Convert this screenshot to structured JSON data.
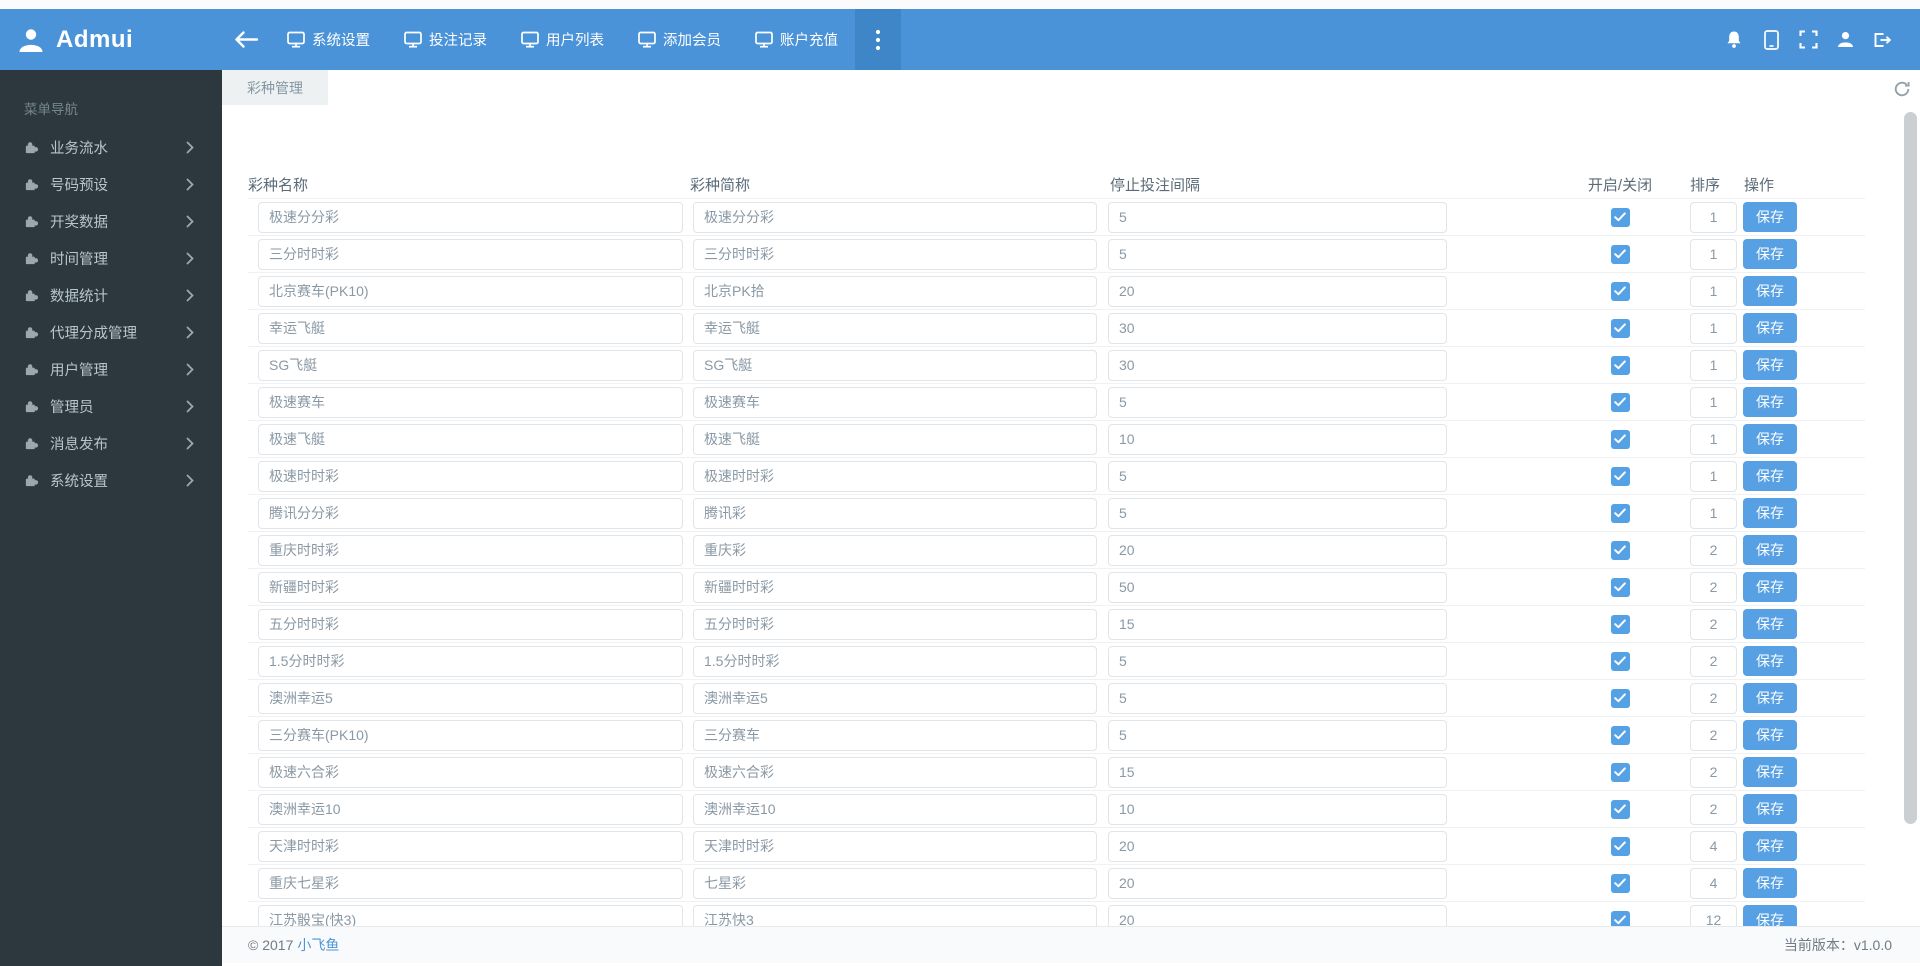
{
  "colors": {
    "navbar_blue": "#4b93d9",
    "navbar_more_darker": "#3f86c9",
    "sidebar_bg": "#2d383e",
    "accent_blue": "#58a0e4",
    "checkbox_blue": "#55a1e6",
    "link_blue": "#4b94d6",
    "tab_bg": "#edf1f2"
  },
  "navbar": {
    "brand": "Admui",
    "items": [
      {
        "label": "系统设置",
        "icon": "monitor-icon"
      },
      {
        "label": "投注记录",
        "icon": "monitor-icon"
      },
      {
        "label": "用户列表",
        "icon": "monitor-icon"
      },
      {
        "label": "添加会员",
        "icon": "monitor-icon"
      },
      {
        "label": "账户充值",
        "icon": "monitor-icon"
      }
    ],
    "right_icons": [
      "bell-icon",
      "tablet-icon",
      "fullscreen-icon",
      "user-icon",
      "logout-icon"
    ]
  },
  "sidebar": {
    "header": "菜单导航",
    "items": [
      {
        "label": "业务流水"
      },
      {
        "label": "号码预设"
      },
      {
        "label": "开奖数据"
      },
      {
        "label": "时间管理"
      },
      {
        "label": "数据统计"
      },
      {
        "label": "代理分成管理"
      },
      {
        "label": "用户管理"
      },
      {
        "label": "管理员"
      },
      {
        "label": "消息发布"
      },
      {
        "label": "系统设置"
      }
    ]
  },
  "tabs": [
    {
      "label": "彩种管理",
      "active": true
    }
  ],
  "table": {
    "headers": [
      "彩种名称",
      "彩种简称",
      "停止投注间隔",
      "开启/关闭",
      "排序",
      "操作"
    ],
    "action_label": "保存",
    "rows": [
      {
        "name": "极速分分彩",
        "short": "极速分分彩",
        "interval": "5",
        "enabled": true,
        "sort": "1"
      },
      {
        "name": "三分时时彩",
        "short": "三分时时彩",
        "interval": "5",
        "enabled": true,
        "sort": "1"
      },
      {
        "name": "北京赛车(PK10)",
        "short": "北京PK拾",
        "interval": "20",
        "enabled": true,
        "sort": "1"
      },
      {
        "name": "幸运飞艇",
        "short": "幸运飞艇",
        "interval": "30",
        "enabled": true,
        "sort": "1"
      },
      {
        "name": "SG飞艇",
        "short": "SG飞艇",
        "interval": "30",
        "enabled": true,
        "sort": "1"
      },
      {
        "name": "极速赛车",
        "short": "极速赛车",
        "interval": "5",
        "enabled": true,
        "sort": "1"
      },
      {
        "name": "极速飞艇",
        "short": "极速飞艇",
        "interval": "10",
        "enabled": true,
        "sort": "1"
      },
      {
        "name": "极速时时彩",
        "short": "极速时时彩",
        "interval": "5",
        "enabled": true,
        "sort": "1"
      },
      {
        "name": "腾讯分分彩",
        "short": "腾讯彩",
        "interval": "5",
        "enabled": true,
        "sort": "1"
      },
      {
        "name": "重庆时时彩",
        "short": "重庆彩",
        "interval": "20",
        "enabled": true,
        "sort": "2"
      },
      {
        "name": "新疆时时彩",
        "short": "新疆时时彩",
        "interval": "50",
        "enabled": true,
        "sort": "2"
      },
      {
        "name": "五分时时彩",
        "short": "五分时时彩",
        "interval": "15",
        "enabled": true,
        "sort": "2"
      },
      {
        "name": "1.5分时时彩",
        "short": "1.5分时时彩",
        "interval": "5",
        "enabled": true,
        "sort": "2"
      },
      {
        "name": "澳洲幸运5",
        "short": "澳洲幸运5",
        "interval": "5",
        "enabled": true,
        "sort": "2"
      },
      {
        "name": "三分赛车(PK10)",
        "short": "三分赛车",
        "interval": "5",
        "enabled": true,
        "sort": "2"
      },
      {
        "name": "极速六合彩",
        "short": "极速六合彩",
        "interval": "15",
        "enabled": true,
        "sort": "2"
      },
      {
        "name": "澳洲幸运10",
        "short": "澳洲幸运10",
        "interval": "10",
        "enabled": true,
        "sort": "2"
      },
      {
        "name": "天津时时彩",
        "short": "天津时时彩",
        "interval": "20",
        "enabled": true,
        "sort": "4"
      },
      {
        "name": "重庆七星彩",
        "short": "七星彩",
        "interval": "20",
        "enabled": true,
        "sort": "4"
      },
      {
        "name": "江苏骰宝(快3)",
        "short": "江苏快3",
        "interval": "20",
        "enabled": true,
        "sort": "12"
      }
    ]
  },
  "footer": {
    "copyright": "© 2017",
    "brand_link": "小飞鱼",
    "version": "当前版本：v1.0.0"
  }
}
